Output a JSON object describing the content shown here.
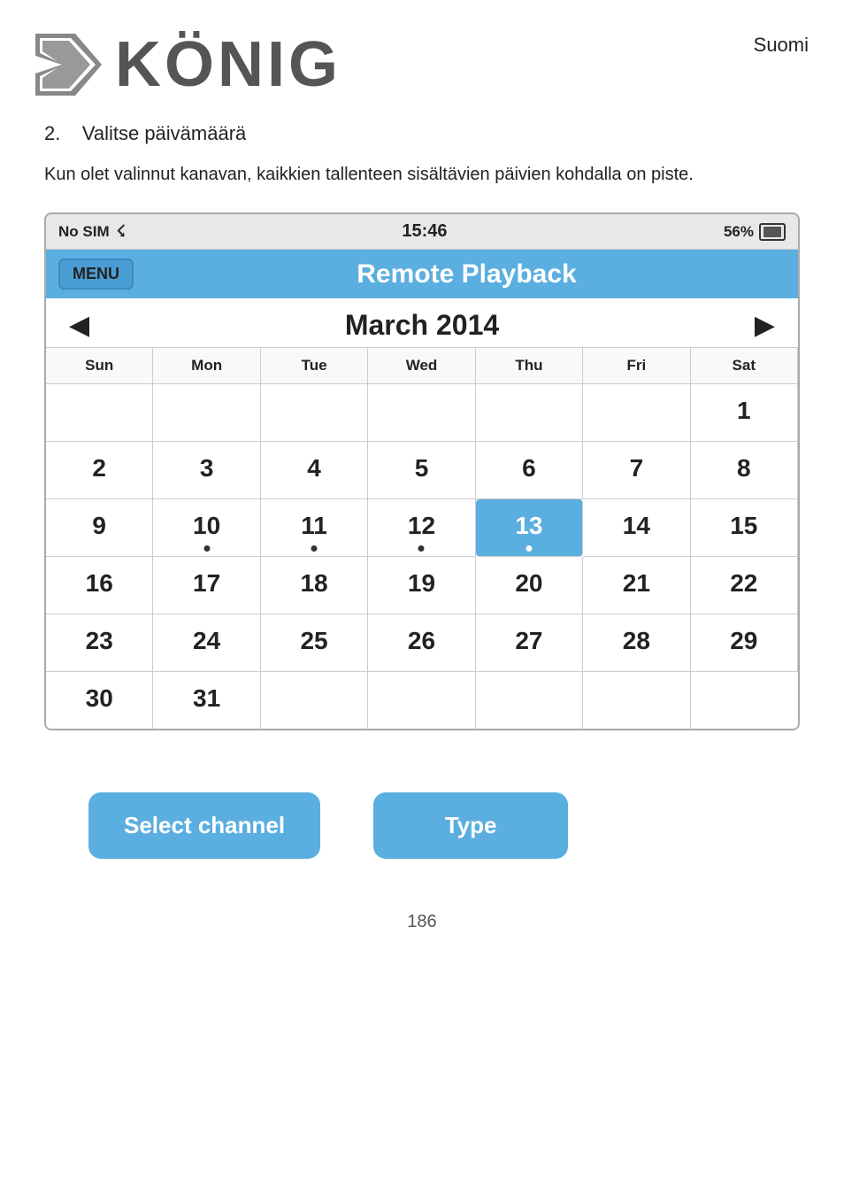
{
  "header": {
    "lang": "Suomi"
  },
  "step": {
    "number": "2.",
    "title": "Valitse päivämäärä"
  },
  "description": "Kun olet valinnut kanavan, kaikkien tallenteen sisältävien päivien kohdalla on piste.",
  "status_bar": {
    "carrier": "No SIM",
    "wifi": "⚇",
    "time": "15:46",
    "battery_pct": "56%"
  },
  "nav": {
    "menu_label": "MENU",
    "title": "Remote Playback"
  },
  "calendar": {
    "month_year": "March 2014",
    "prev_arrow": "◀",
    "next_arrow": "▶",
    "day_headers": [
      "Sun",
      "Mon",
      "Tue",
      "Wed",
      "Thu",
      "Fri",
      "Sat"
    ],
    "rows": [
      [
        {
          "day": "",
          "empty": true
        },
        {
          "day": "",
          "empty": true
        },
        {
          "day": "",
          "empty": true
        },
        {
          "day": "",
          "empty": true
        },
        {
          "day": "",
          "empty": true
        },
        {
          "day": "",
          "empty": true
        },
        {
          "day": "1",
          "has_dot": false
        }
      ],
      [
        {
          "day": "2",
          "has_dot": false
        },
        {
          "day": "3",
          "has_dot": false
        },
        {
          "day": "4",
          "has_dot": false
        },
        {
          "day": "5",
          "has_dot": false
        },
        {
          "day": "6",
          "has_dot": false
        },
        {
          "day": "7",
          "has_dot": false
        },
        {
          "day": "8",
          "has_dot": false
        }
      ],
      [
        {
          "day": "9",
          "has_dot": false
        },
        {
          "day": "10",
          "has_dot": true
        },
        {
          "day": "11",
          "has_dot": true
        },
        {
          "day": "12",
          "has_dot": true
        },
        {
          "day": "13",
          "has_dot": true,
          "selected": true
        },
        {
          "day": "14",
          "has_dot": false
        },
        {
          "day": "15",
          "has_dot": false
        }
      ],
      [
        {
          "day": "16",
          "has_dot": false
        },
        {
          "day": "17",
          "has_dot": false
        },
        {
          "day": "18",
          "has_dot": false
        },
        {
          "day": "19",
          "has_dot": false
        },
        {
          "day": "20",
          "has_dot": false
        },
        {
          "day": "21",
          "has_dot": false
        },
        {
          "day": "22",
          "has_dot": false
        }
      ],
      [
        {
          "day": "23",
          "has_dot": false
        },
        {
          "day": "24",
          "has_dot": false
        },
        {
          "day": "25",
          "has_dot": false
        },
        {
          "day": "26",
          "has_dot": false
        },
        {
          "day": "27",
          "has_dot": false
        },
        {
          "day": "28",
          "has_dot": false
        },
        {
          "day": "29",
          "has_dot": false
        }
      ],
      [
        {
          "day": "30",
          "has_dot": false
        },
        {
          "day": "31",
          "has_dot": false
        },
        {
          "day": "",
          "empty": true
        },
        {
          "day": "",
          "empty": true
        },
        {
          "day": "",
          "empty": true
        },
        {
          "day": "",
          "empty": true
        },
        {
          "day": "",
          "empty": true
        }
      ]
    ]
  },
  "buttons": {
    "select_channel": "Select channel",
    "type": "Type"
  },
  "footer": {
    "page_number": "186"
  }
}
